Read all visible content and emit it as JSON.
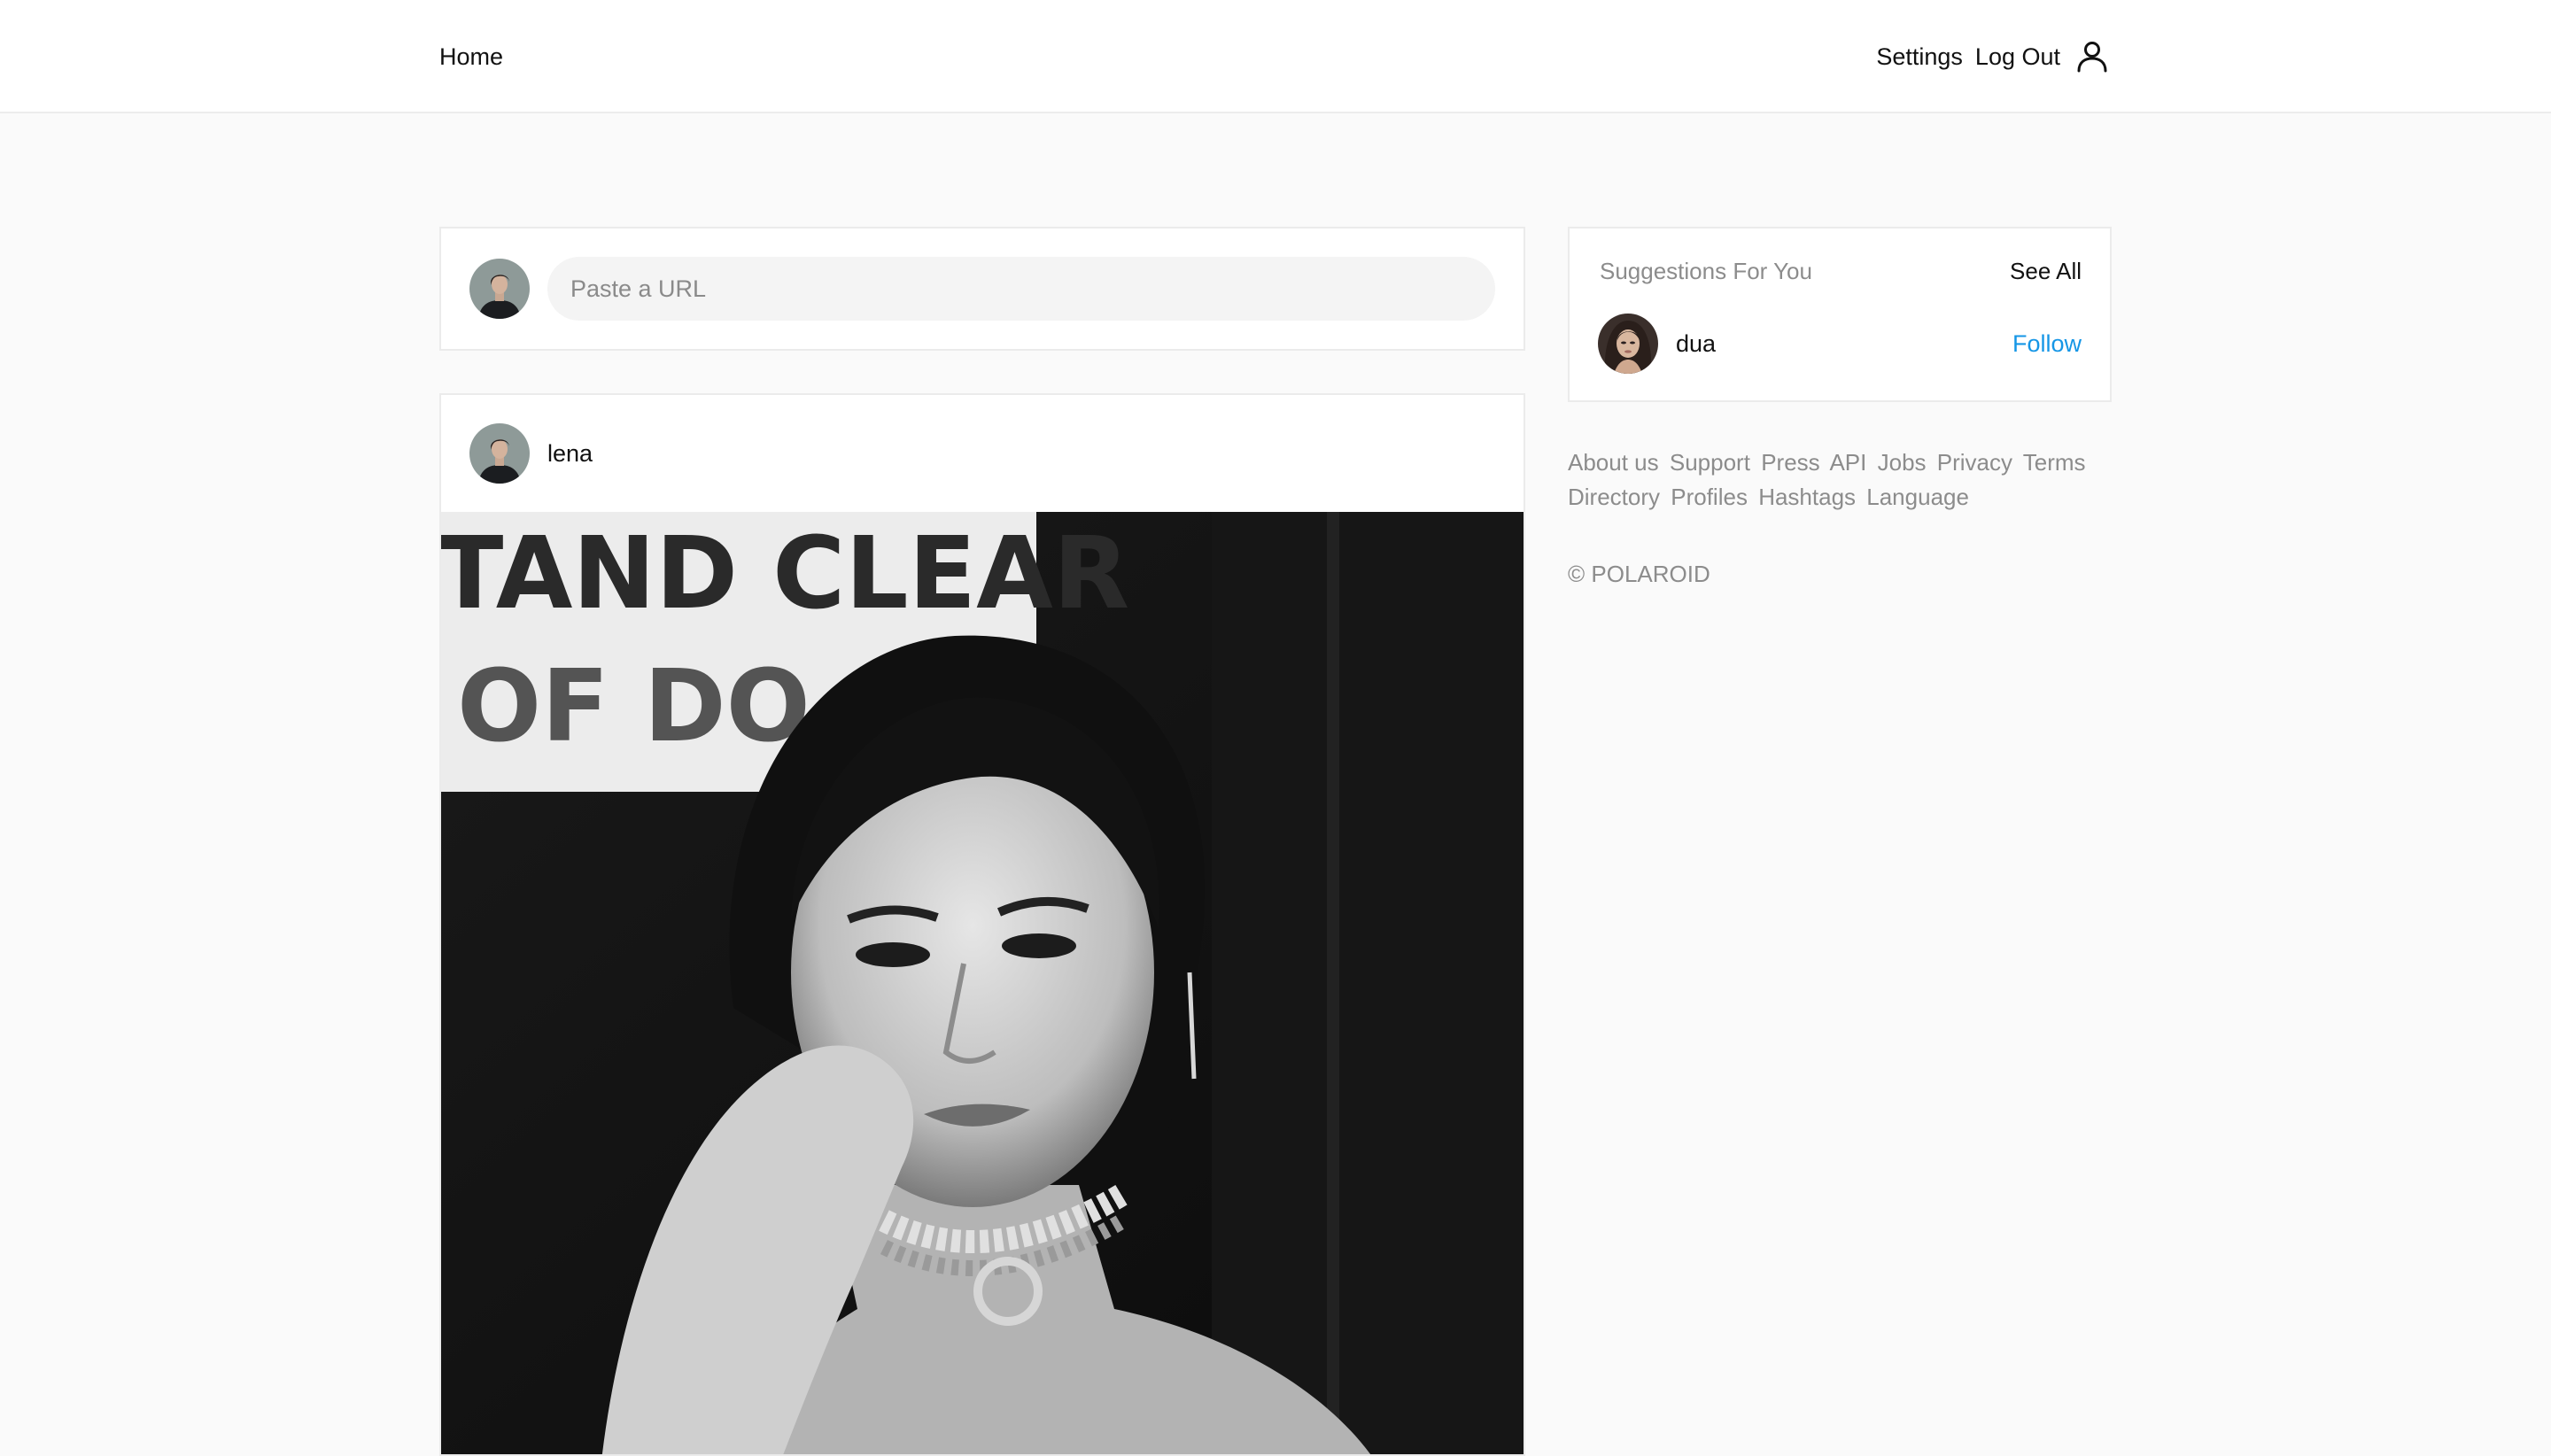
{
  "header": {
    "home_label": "Home",
    "settings_label": "Settings",
    "logout_label": "Log Out",
    "profile_icon": "user-icon"
  },
  "composer": {
    "placeholder": "Paste a URL",
    "value": ""
  },
  "post": {
    "author": "lena",
    "image_sign_text": [
      "TAND CLEAR",
      "OF DO"
    ]
  },
  "suggestions": {
    "title": "Suggestions For You",
    "see_all_label": "See All",
    "items": [
      {
        "name": "dua",
        "action_label": "Follow"
      }
    ]
  },
  "footer": {
    "links": [
      "About us",
      "Support",
      "Press",
      "API",
      "Jobs",
      "Privacy",
      "Terms",
      "Directory",
      "Profiles",
      "Hashtags",
      "Language"
    ],
    "copyright": "© POLAROID"
  },
  "colors": {
    "page_background": "#fafafa",
    "card_background": "#ffffff",
    "border": "#ebebeb",
    "muted_text": "#8c8c8c",
    "accent_link": "#1596e6"
  }
}
